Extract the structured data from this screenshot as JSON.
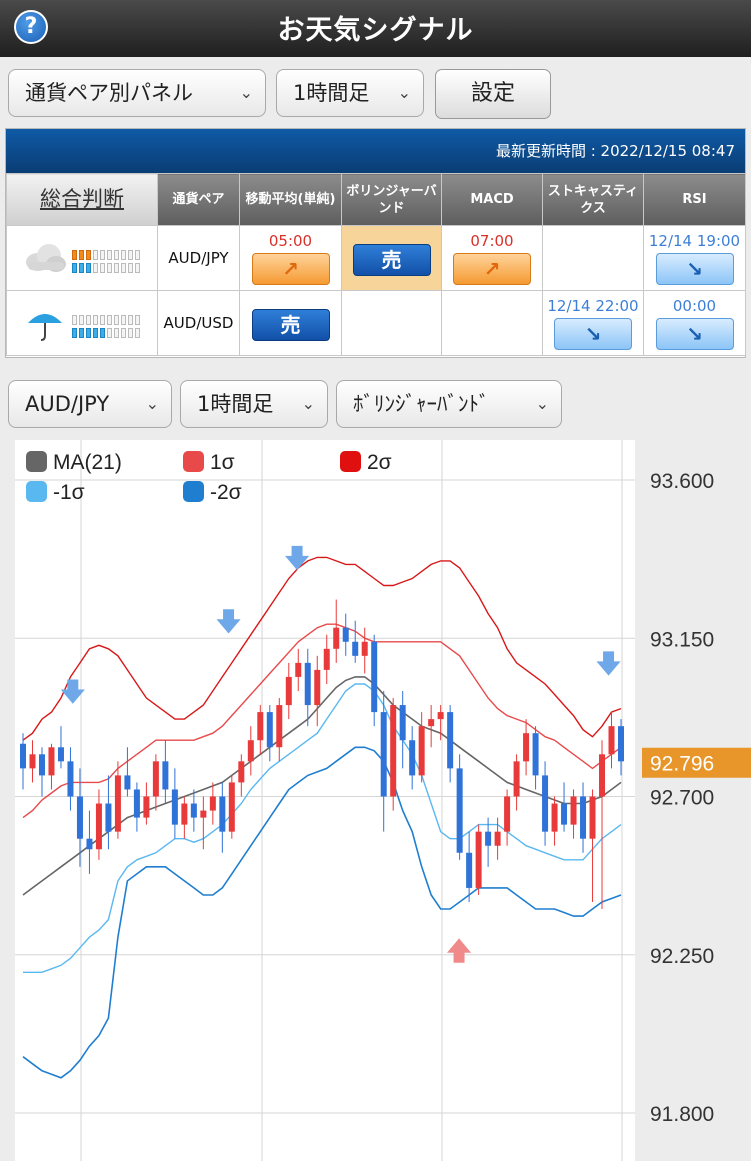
{
  "app": {
    "title": "お天気シグナル",
    "help": "?"
  },
  "toolbar": {
    "panel_select": "通貨ペア別パネル",
    "timeframe_select": "1時間足",
    "settings_label": "設定"
  },
  "panel": {
    "updated": "最新更新時間 : 2022/12/15 08:47",
    "headers": {
      "overall": "総合判断",
      "pair": "通貨ペア",
      "ma": "移動平均(単純)",
      "bb": "ボリンジャーバンド",
      "macd": "MACD",
      "stoch": "ストキャスティクス",
      "rsi": "RSI"
    },
    "rows": [
      {
        "weather_icon": "cloud-icon",
        "pair": "AUD/JPY",
        "orange_bars": 3,
        "blue_bars": 3,
        "ma": {
          "time": "05:00",
          "signal": "up"
        },
        "bb": {
          "label": "売",
          "highlight": true
        },
        "macd": {
          "time": "07:00",
          "signal": "up"
        },
        "stoch": null,
        "rsi": {
          "time": "12/14 19:00",
          "signal": "down"
        }
      },
      {
        "weather_icon": "umbrella-icon",
        "pair": "AUD/USD",
        "orange_bars": 0,
        "blue_bars": 5,
        "ma": {
          "label": "売"
        },
        "bb": null,
        "macd": null,
        "stoch": {
          "time": "12/14 22:00",
          "signal": "down"
        },
        "rsi": {
          "time": "00:00",
          "signal": "down"
        }
      }
    ]
  },
  "chart_controls": {
    "pair_select": "AUD/JPY",
    "timeframe_select": "1時間足",
    "indicator_select": "ﾎﾞﾘﾝｼﾞｬｰﾊﾞﾝﾄﾞ"
  },
  "chart_data": {
    "type": "candlestick",
    "legend": [
      {
        "name": "MA(21)",
        "color": "#666666"
      },
      {
        "name": "1σ",
        "color": "#e84a4a"
      },
      {
        "name": "2σ",
        "color": "#e01010"
      },
      {
        "name": "-1σ",
        "color": "#5ab8f0"
      },
      {
        "name": "-2σ",
        "color": "#1f7ed0"
      }
    ],
    "y_ticks": [
      "93.600",
      "93.150",
      "92.700",
      "92.250",
      "91.800"
    ],
    "ylim": [
      91.8,
      93.6
    ],
    "current_price": "92.796",
    "colors": {
      "up": "#e83a3a",
      "down": "#2f72d8",
      "current": "#e8962a"
    },
    "candles": [
      [
        92.85,
        92.88,
        92.72,
        92.78
      ],
      [
        92.78,
        92.86,
        92.74,
        92.82
      ],
      [
        92.82,
        92.84,
        92.7,
        92.76
      ],
      [
        92.76,
        92.85,
        92.72,
        92.84
      ],
      [
        92.84,
        92.9,
        92.78,
        92.8
      ],
      [
        92.8,
        92.84,
        92.66,
        92.7
      ],
      [
        92.7,
        92.78,
        92.5,
        92.58
      ],
      [
        92.58,
        92.66,
        92.48,
        92.55
      ],
      [
        92.55,
        92.72,
        92.52,
        92.68
      ],
      [
        92.68,
        92.76,
        92.55,
        92.6
      ],
      [
        92.6,
        92.8,
        92.58,
        92.76
      ],
      [
        92.76,
        92.84,
        92.7,
        92.72
      ],
      [
        92.72,
        92.74,
        92.6,
        92.64
      ],
      [
        92.64,
        92.74,
        92.62,
        92.7
      ],
      [
        92.7,
        92.82,
        92.66,
        92.8
      ],
      [
        92.8,
        92.86,
        92.68,
        92.72
      ],
      [
        92.72,
        92.78,
        92.58,
        92.62
      ],
      [
        92.62,
        92.7,
        92.58,
        92.68
      ],
      [
        92.68,
        92.72,
        92.6,
        92.64
      ],
      [
        92.64,
        92.7,
        92.55,
        92.66
      ],
      [
        92.66,
        92.74,
        92.62,
        92.7
      ],
      [
        92.7,
        92.74,
        92.54,
        92.6
      ],
      [
        92.6,
        92.76,
        92.58,
        92.74
      ],
      [
        92.74,
        92.82,
        92.7,
        92.8
      ],
      [
        92.8,
        92.9,
        92.76,
        92.86
      ],
      [
        92.86,
        92.96,
        92.82,
        92.94
      ],
      [
        92.94,
        92.96,
        92.8,
        92.84
      ],
      [
        92.84,
        92.98,
        92.8,
        92.96
      ],
      [
        92.96,
        93.08,
        92.92,
        93.04
      ],
      [
        93.04,
        93.12,
        93.0,
        93.08
      ],
      [
        93.08,
        93.12,
        92.9,
        92.96
      ],
      [
        92.96,
        93.1,
        92.9,
        93.06
      ],
      [
        93.06,
        93.16,
        93.02,
        93.12
      ],
      [
        93.12,
        93.26,
        93.08,
        93.18
      ],
      [
        93.18,
        93.22,
        93.1,
        93.14
      ],
      [
        93.14,
        93.2,
        93.08,
        93.1
      ],
      [
        93.1,
        93.18,
        93.05,
        93.14
      ],
      [
        93.14,
        93.16,
        92.9,
        92.94
      ],
      [
        92.94,
        93.0,
        92.6,
        92.7
      ],
      [
        92.7,
        92.98,
        92.66,
        92.96
      ],
      [
        92.96,
        93.0,
        92.78,
        92.86
      ],
      [
        92.86,
        92.9,
        92.72,
        92.76
      ],
      [
        92.76,
        92.94,
        92.74,
        92.9
      ],
      [
        92.9,
        92.96,
        92.84,
        92.92
      ],
      [
        92.92,
        92.96,
        92.86,
        92.94
      ],
      [
        92.94,
        92.96,
        92.74,
        92.78
      ],
      [
        92.78,
        92.82,
        92.52,
        92.54
      ],
      [
        92.54,
        92.6,
        92.4,
        92.44
      ],
      [
        92.44,
        92.62,
        92.42,
        92.6
      ],
      [
        92.6,
        92.64,
        92.5,
        92.56
      ],
      [
        92.56,
        92.64,
        92.52,
        92.6
      ],
      [
        92.6,
        92.72,
        92.56,
        92.7
      ],
      [
        92.7,
        92.82,
        92.66,
        92.8
      ],
      [
        92.8,
        92.92,
        92.76,
        92.88
      ],
      [
        92.88,
        92.9,
        92.72,
        92.76
      ],
      [
        92.76,
        92.8,
        92.56,
        92.6
      ],
      [
        92.6,
        92.7,
        92.56,
        92.68
      ],
      [
        92.68,
        92.74,
        92.6,
        92.62
      ],
      [
        92.62,
        92.72,
        92.58,
        92.7
      ],
      [
        92.7,
        92.74,
        92.54,
        92.58
      ],
      [
        92.58,
        92.72,
        92.4,
        92.7
      ],
      [
        92.7,
        92.86,
        92.38,
        92.82
      ],
      [
        92.82,
        92.94,
        92.78,
        92.9
      ],
      [
        92.9,
        92.92,
        92.76,
        92.8
      ]
    ],
    "bands": {
      "ma": [
        92.42,
        92.44,
        92.46,
        92.48,
        92.5,
        92.52,
        92.54,
        92.56,
        92.58,
        92.6,
        92.62,
        92.64,
        92.65,
        92.66,
        92.67,
        92.68,
        92.69,
        92.7,
        92.71,
        92.72,
        92.73,
        92.74,
        92.76,
        92.78,
        92.8,
        92.82,
        92.84,
        92.86,
        92.88,
        92.9,
        92.92,
        92.95,
        92.98,
        93.01,
        93.03,
        93.04,
        93.04,
        93.02,
        92.99,
        92.96,
        92.94,
        92.92,
        92.9,
        92.89,
        92.88,
        92.86,
        92.84,
        92.82,
        92.8,
        92.78,
        92.76,
        92.74,
        92.73,
        92.72,
        92.71,
        92.7,
        92.69,
        92.68,
        92.68,
        92.68,
        92.69,
        92.7,
        92.72,
        92.74
      ],
      "u1": [
        92.64,
        92.66,
        92.69,
        92.71,
        92.73,
        92.74,
        92.74,
        92.74,
        92.74,
        92.75,
        92.78,
        92.8,
        92.82,
        92.84,
        92.86,
        92.86,
        92.86,
        92.86,
        92.86,
        92.87,
        92.88,
        92.9,
        92.93,
        92.96,
        92.99,
        93.02,
        93.05,
        93.08,
        93.11,
        93.14,
        93.16,
        93.18,
        93.19,
        93.19,
        93.18,
        93.17,
        93.15,
        93.14,
        93.14,
        93.14,
        93.14,
        93.14,
        93.14,
        93.14,
        93.14,
        93.12,
        93.1,
        93.06,
        93.02,
        92.98,
        92.95,
        92.93,
        92.92,
        92.91,
        92.89,
        92.87,
        92.86,
        92.84,
        92.82,
        92.8,
        92.78,
        92.8,
        92.82,
        92.84
      ],
      "u2": [
        92.86,
        92.88,
        92.92,
        92.94,
        92.98,
        93.04,
        93.08,
        93.12,
        93.13,
        93.12,
        93.1,
        93.06,
        93.02,
        92.98,
        92.96,
        92.94,
        92.92,
        92.92,
        92.94,
        92.96,
        93.0,
        93.04,
        93.08,
        93.12,
        93.16,
        93.2,
        93.24,
        93.28,
        93.32,
        93.35,
        93.37,
        93.38,
        93.38,
        93.37,
        93.36,
        93.36,
        93.34,
        93.32,
        93.3,
        93.3,
        93.31,
        93.32,
        93.34,
        93.36,
        93.37,
        93.37,
        93.35,
        93.31,
        93.27,
        93.22,
        93.18,
        93.12,
        93.08,
        93.06,
        93.04,
        93.02,
        92.99,
        92.96,
        92.93,
        92.89,
        92.87,
        92.9,
        92.94,
        92.95
      ],
      "l1": [
        92.2,
        92.2,
        92.2,
        92.21,
        92.22,
        92.24,
        92.27,
        92.3,
        92.32,
        92.35,
        92.46,
        92.5,
        92.52,
        92.53,
        92.54,
        92.56,
        92.58,
        92.58,
        92.57,
        92.58,
        92.6,
        92.62,
        92.65,
        92.68,
        92.72,
        92.75,
        92.78,
        92.8,
        92.82,
        92.84,
        92.86,
        92.88,
        92.92,
        92.96,
        93.0,
        93.02,
        93.02,
        93.0,
        92.96,
        92.9,
        92.86,
        92.82,
        92.76,
        92.68,
        92.6,
        92.58,
        92.58,
        92.6,
        92.62,
        92.62,
        92.62,
        92.6,
        92.58,
        92.56,
        92.55,
        92.54,
        92.53,
        92.52,
        92.52,
        92.52,
        92.55,
        92.58,
        92.6,
        92.62
      ],
      "l2": [
        91.96,
        91.94,
        91.92,
        91.91,
        91.9,
        91.92,
        91.95,
        91.99,
        92.02,
        92.07,
        92.3,
        92.46,
        92.48,
        92.5,
        92.5,
        92.5,
        92.48,
        92.46,
        92.44,
        92.42,
        92.42,
        92.44,
        92.48,
        92.52,
        92.56,
        92.6,
        92.64,
        92.68,
        92.72,
        92.74,
        92.76,
        92.77,
        92.78,
        92.8,
        92.82,
        92.84,
        92.84,
        92.83,
        92.8,
        92.74,
        92.66,
        92.6,
        92.5,
        92.42,
        92.38,
        92.38,
        92.4,
        92.42,
        92.44,
        92.44,
        92.44,
        92.44,
        92.42,
        92.4,
        92.38,
        92.38,
        92.38,
        92.37,
        92.36,
        92.36,
        92.38,
        92.4,
        92.41,
        92.42
      ]
    },
    "signals": [
      {
        "index": 8,
        "dir": "down",
        "price": 92.98
      },
      {
        "index": 33,
        "dir": "down",
        "price": 93.18
      },
      {
        "index": 44,
        "dir": "down",
        "price": 93.36
      },
      {
        "index": 70,
        "dir": "up",
        "price": 92.28
      },
      {
        "index": 94,
        "dir": "down",
        "price": 93.06
      }
    ]
  }
}
